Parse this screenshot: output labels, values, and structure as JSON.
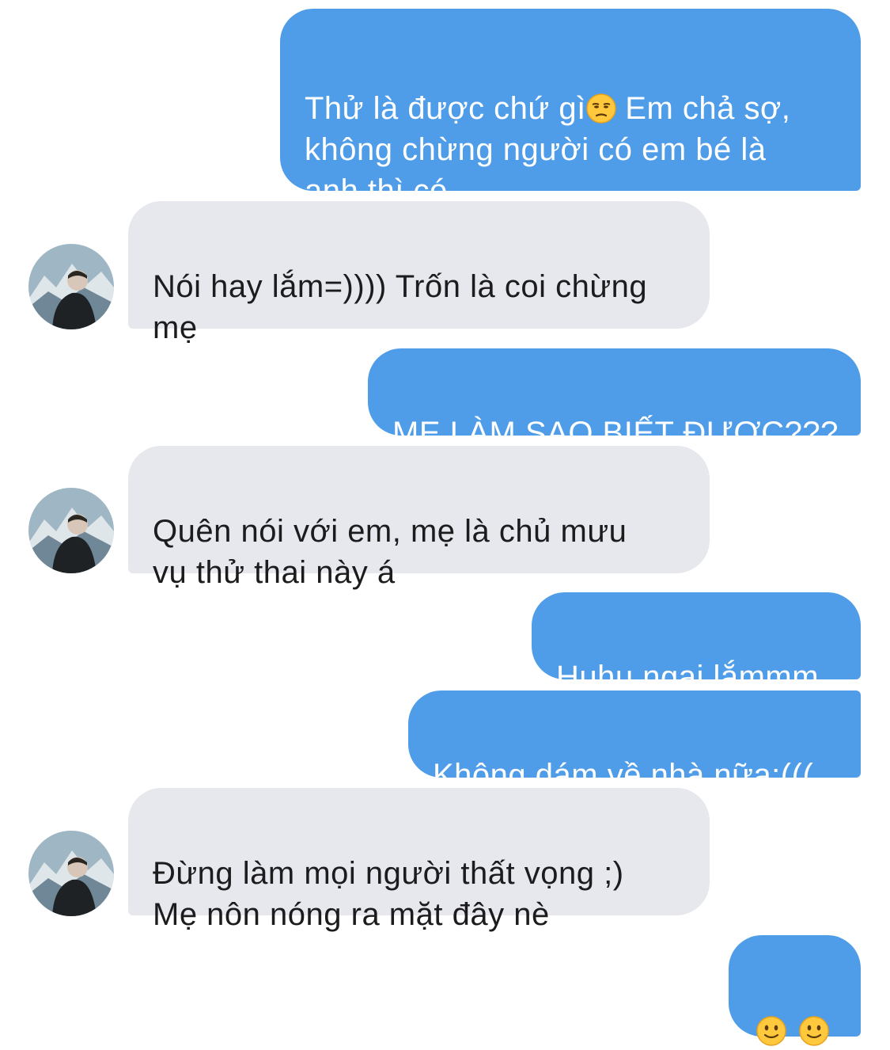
{
  "messages": [
    {
      "id": "m1",
      "side": "outgoing",
      "text_before_emoji": "Thử là được chứ gì",
      "emoji": "unamused-face",
      "text_after_emoji": " Em chả sợ,\nkhông chừng người có em bé là\nanh thì có"
    },
    {
      "id": "m2",
      "side": "incoming",
      "text": "Nói hay lắm=)))) Trốn là coi chừng\nmẹ"
    },
    {
      "id": "m3",
      "side": "outgoing",
      "text": "MẸ LÀM SAO BIẾT ĐƯỢC???"
    },
    {
      "id": "m4",
      "side": "incoming",
      "text": "Quên nói với em, mẹ là chủ mưu\nvụ thử thai này á"
    },
    {
      "id": "m5",
      "side": "outgoing",
      "text": "Huhu ngại lắmmm"
    },
    {
      "id": "m6",
      "side": "outgoing",
      "text": "Không dám về nhà nữa:((("
    },
    {
      "id": "m7",
      "side": "incoming",
      "text": "Đừng làm mọi người thất vọng ;)\nMẹ nôn nóng ra mặt đây nè"
    },
    {
      "id": "m8",
      "side": "outgoing",
      "emojis": [
        "slightly-smiling-face",
        "slightly-smiling-face"
      ]
    }
  ],
  "colors": {
    "outgoing_bubble": "#4f9de8",
    "incoming_bubble": "#e6e8ed",
    "outgoing_text": "#ffffff",
    "incoming_text": "#1c1c1e",
    "background": "#ffffff"
  },
  "avatar": {
    "icon": "contact-avatar-photo"
  }
}
